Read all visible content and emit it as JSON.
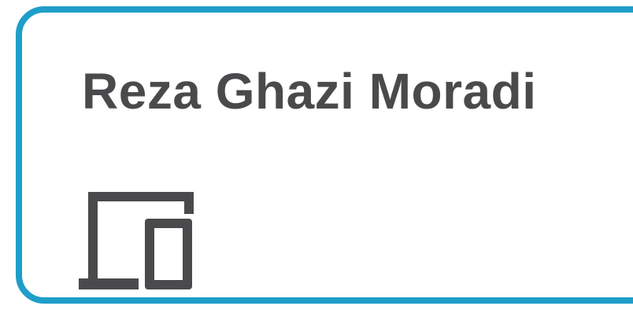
{
  "card": {
    "name": "Reza Ghazi Moradi",
    "icon": "laptop-tablet-devices-icon",
    "border_color": "#1e9ec9",
    "text_color": "#4a4a4d",
    "icon_color": "#4a4a4d"
  }
}
